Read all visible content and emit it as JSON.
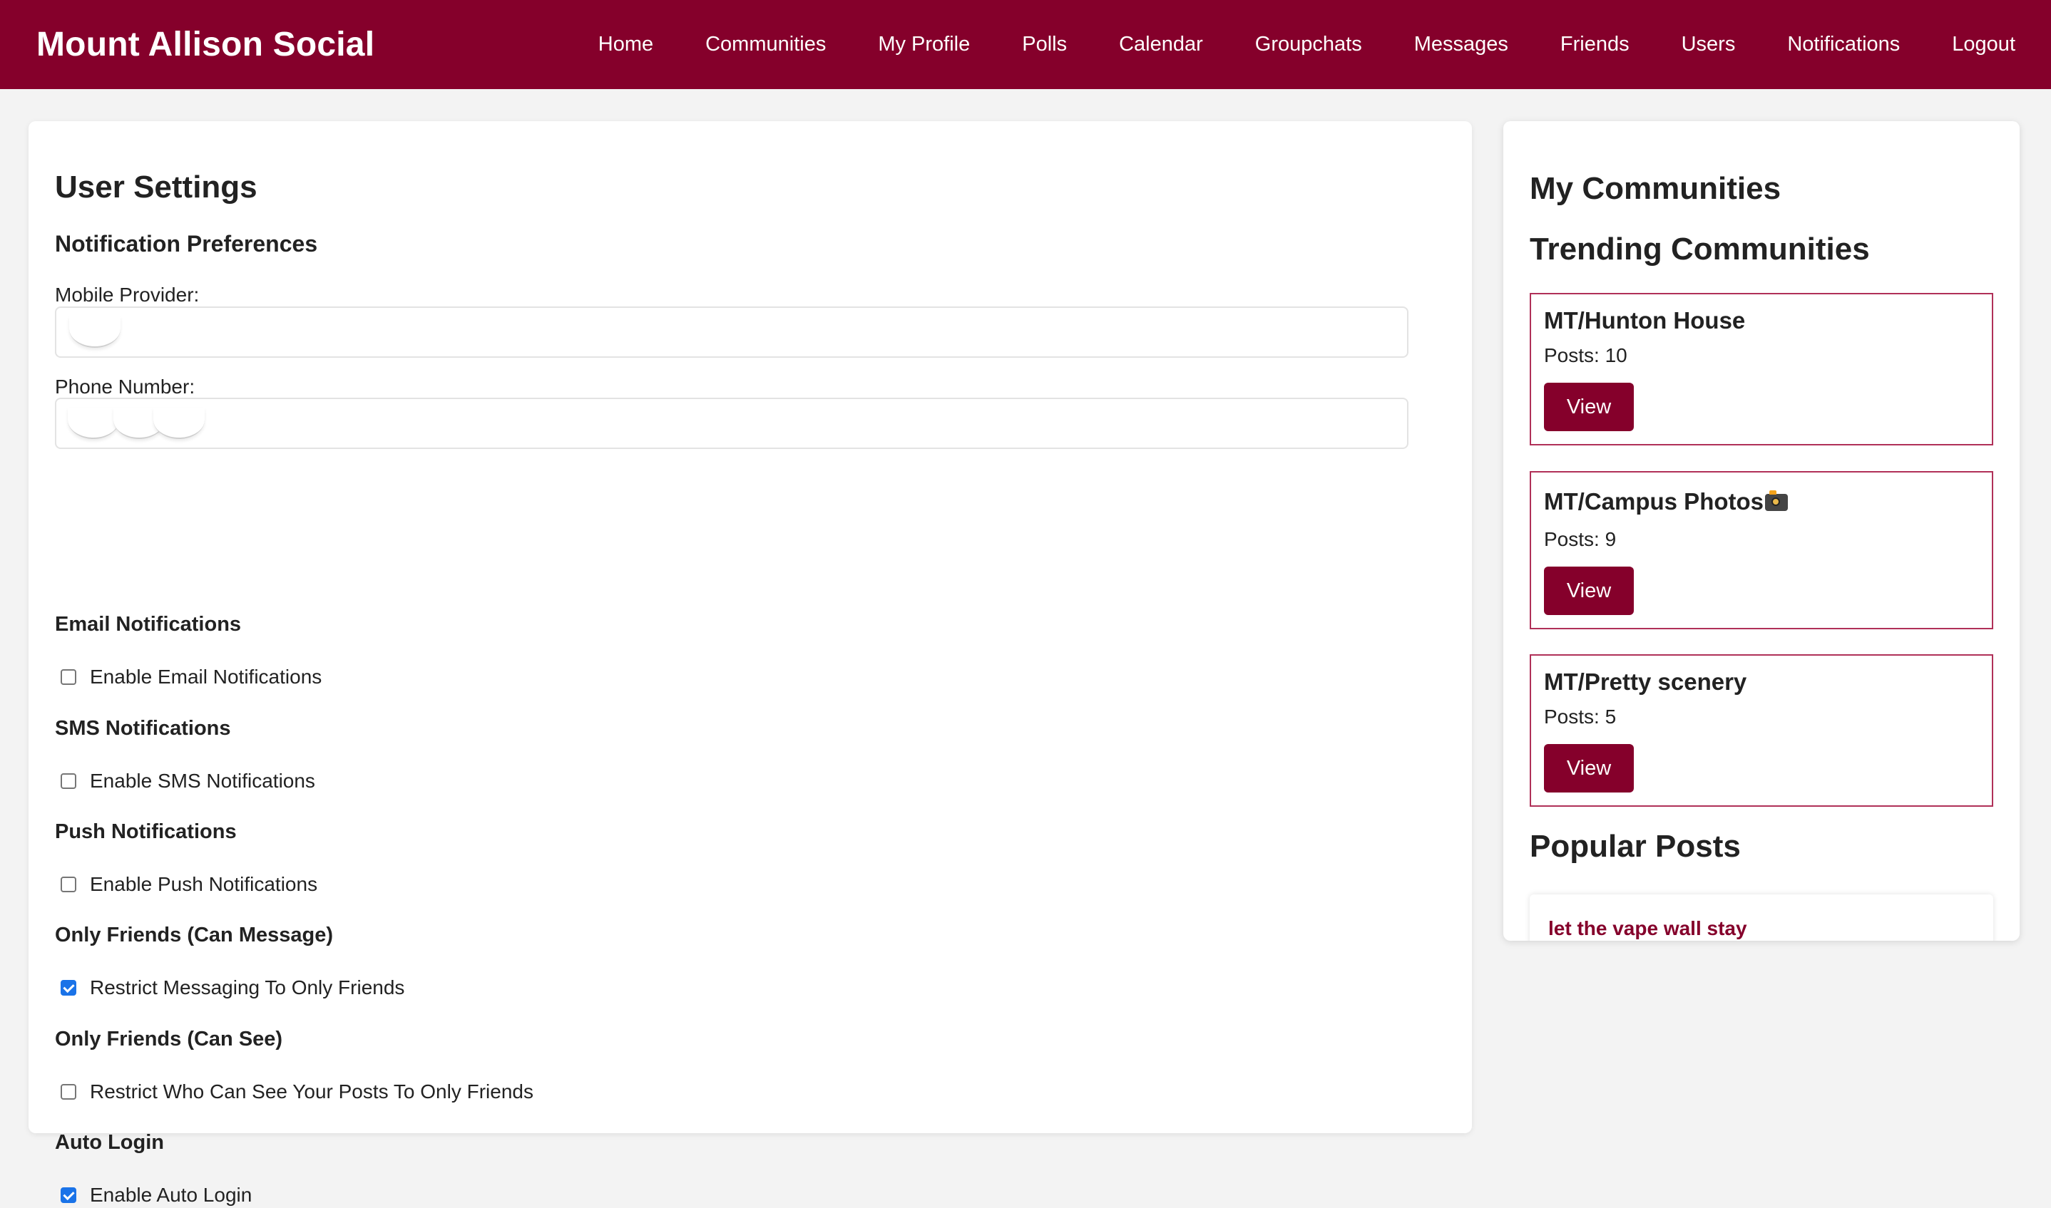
{
  "brand": "Mount Allison Social",
  "nav": [
    "Home",
    "Communities",
    "My Profile",
    "Polls",
    "Calendar",
    "Groupchats",
    "Messages",
    "Friends",
    "Users",
    "Notifications",
    "Logout"
  ],
  "settings": {
    "title": "User Settings",
    "subtitle": "Notification Preferences",
    "mobile_provider_label": "Mobile Provider:",
    "phone_number_label": "Phone Number:",
    "sections": [
      {
        "heading": "Email Notifications",
        "option": "Enable Email Notifications",
        "checked": false
      },
      {
        "heading": "SMS Notifications",
        "option": "Enable SMS Notifications",
        "checked": false
      },
      {
        "heading": "Push Notifications",
        "option": "Enable Push Notifications",
        "checked": false
      },
      {
        "heading": "Only Friends (Can Message)",
        "option": "Restrict Messaging To Only Friends",
        "checked": true
      },
      {
        "heading": "Only Friends (Can See)",
        "option": "Restrict Who Can See Your Posts To Only Friends",
        "checked": false
      },
      {
        "heading": "Auto Login",
        "option": "Enable Auto Login",
        "checked": true
      }
    ]
  },
  "sidebar": {
    "my_communities": "My Communities",
    "trending_communities": "Trending Communities",
    "communities": [
      {
        "name": "MT/Hunton House",
        "posts": "Posts: 10",
        "button": "View"
      },
      {
        "name": "MT/Campus Photos",
        "posts": "Posts: 9",
        "button": "View",
        "icon": "camera-icon"
      },
      {
        "name": "MT/Pretty scenery",
        "posts": "Posts: 5",
        "button": "View"
      }
    ],
    "popular_posts": "Popular Posts",
    "posts": [
      {
        "title": "let the vape wall stay"
      }
    ]
  },
  "colors": {
    "brand": "#85002b",
    "card_border": "#b03058",
    "checkbox": "#1a73e8",
    "page_bg": "#f3f3f3"
  }
}
